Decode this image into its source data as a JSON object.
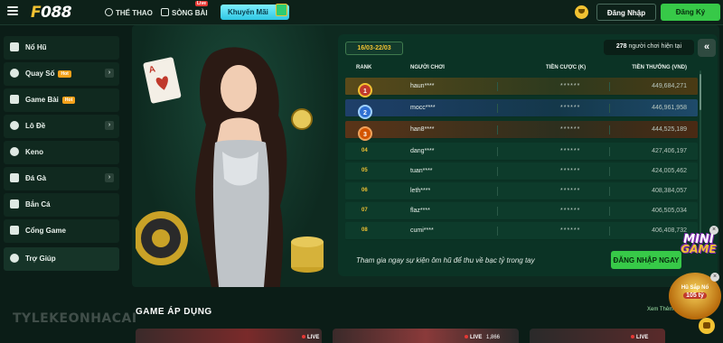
{
  "header": {
    "logo": "F088",
    "nav": [
      "THỂ THAO",
      "SÒNG BÀI"
    ],
    "live_tag": "Live",
    "promo": "Khuyến Mãi",
    "login": "Đăng Nhập",
    "register": "Đăng Ký"
  },
  "sidebar": {
    "items": [
      {
        "label": "Nổ Hũ",
        "hot": "",
        "expand": ""
      },
      {
        "label": "Quay Số",
        "hot": "Hot",
        "expand": "›"
      },
      {
        "label": "Game Bài",
        "hot": "Hot",
        "expand": ""
      },
      {
        "label": "Lô Đề",
        "hot": "",
        "expand": "›"
      },
      {
        "label": "Keno",
        "hot": "",
        "expand": ""
      },
      {
        "label": "Đá Gà",
        "hot": "",
        "expand": "›"
      },
      {
        "label": "Bắn Cá",
        "hot": "",
        "expand": ""
      },
      {
        "label": "Cổng Game",
        "hot": "",
        "expand": ""
      },
      {
        "label": "Trợ Giúp",
        "hot": "",
        "expand": ""
      }
    ]
  },
  "leaderboard": {
    "date_range": "16/03-22/03",
    "online_count": "278",
    "online_text": "người chơi hiện tại",
    "collapse": "«",
    "columns": [
      "RANK",
      "NGƯỜI CHƠI",
      "TIỀN CƯỢC (K)",
      "TIỀN THƯỞNG (VND)"
    ],
    "rows": [
      {
        "rank": "1",
        "player": "haun****",
        "bet": "******",
        "prize": "449,684,271"
      },
      {
        "rank": "2",
        "player": "mocc****",
        "bet": "******",
        "prize": "446,961,958"
      },
      {
        "rank": "3",
        "player": "han8****",
        "bet": "******",
        "prize": "444,525,189"
      },
      {
        "rank": "04",
        "player": "dang****",
        "bet": "******",
        "prize": "427,406,197"
      },
      {
        "rank": "05",
        "player": "tuan****",
        "bet": "******",
        "prize": "424,005,462"
      },
      {
        "rank": "06",
        "player": "leth****",
        "bet": "******",
        "prize": "408,384,057"
      },
      {
        "rank": "07",
        "player": "flaz****",
        "bet": "******",
        "prize": "406,505,034"
      },
      {
        "rank": "08",
        "player": "cumi****",
        "bet": "******",
        "prize": "406,408,732"
      }
    ],
    "cta_text": "Tham gia ngay sự kiện ôm hũ để thu về bạc tỷ trong tay",
    "cta_button": "ĐĂNG NHẬP NGAY"
  },
  "games": {
    "section_title": "GAME ÁP DỤNG",
    "more": "Xem Thêm",
    "cards": [
      {
        "live": "LIVE",
        "count": ""
      },
      {
        "live": "LIVE",
        "count": "1,866"
      },
      {
        "live": "LIVE",
        "count": ""
      }
    ]
  },
  "floating": {
    "mini_line1": "MINI",
    "mini_line2": "GAME",
    "jackpot_title": "Hũ Sắp Nổ",
    "jackpot_value": "105 tỷ",
    "close": "×"
  },
  "watermark": "TYLEKEONHACAI"
}
